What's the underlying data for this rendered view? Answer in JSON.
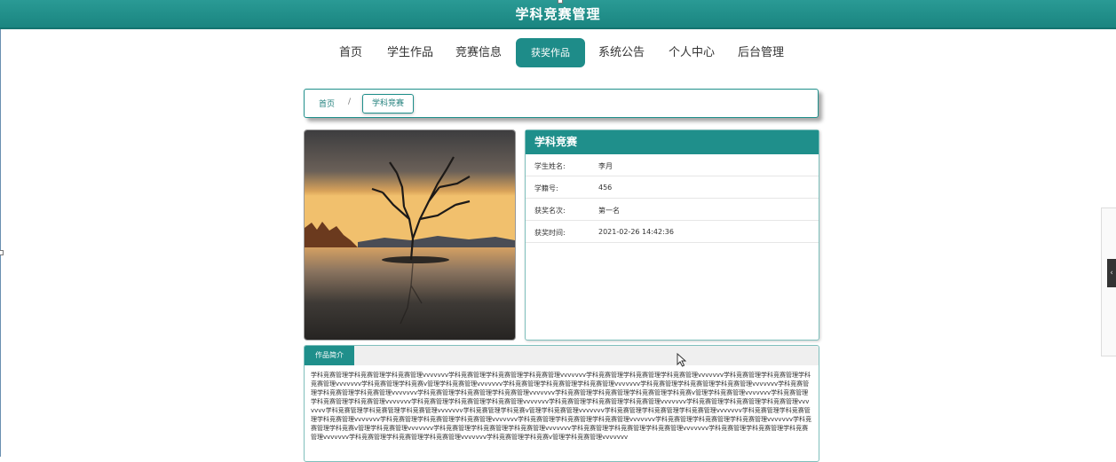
{
  "header": {
    "title": "学科竞赛管理"
  },
  "nav": {
    "items": [
      {
        "label": "首页"
      },
      {
        "label": "学生作品"
      },
      {
        "label": "竞赛信息"
      },
      {
        "label": "获奖作品"
      },
      {
        "label": "系统公告"
      },
      {
        "label": "个人中心"
      },
      {
        "label": "后台管理"
      }
    ],
    "active": "获奖作品"
  },
  "breadcrumb": {
    "home": "首页",
    "separator": "/",
    "current": "学科竞赛"
  },
  "detail": {
    "title": "学科竞赛",
    "fields": [
      {
        "label": "学生姓名:",
        "value": "李月"
      },
      {
        "label": "学籍号:",
        "value": "456"
      },
      {
        "label": "获奖名次:",
        "value": "第一名"
      },
      {
        "label": "获奖时间:",
        "value": "2021-02-26 14:42:36"
      }
    ]
  },
  "description": {
    "tab": "作品简介",
    "text": "学科竞赛管理学科竞赛管理学科竞赛管理vvvvvvv学科竞赛管理学科竞赛管理学科竞赛管理vvvvvvv学科竞赛管理学科竞赛管理学科竞赛管理vvvvvvv学科竞赛管理学科竞赛管理学科竞赛管理vvvvvvv学科竞赛管理学科竞赛v管理学科竞赛管理vvvvvvv学科竞赛管理学科竞赛管理学科竞赛管理vvvvvvv学科竞赛管理学科竞赛管理学科竞赛管理vvvvvvv学科竞赛管理学科竞赛管理学科竞赛管理vvvvvvv学科竞赛管理学科竞赛管理学科竞赛管理vvvvvvv学科竞赛管理学科竞赛管理学科竞赛管理学科竞赛v管理学科竞赛管理vvvvvvv学科竞赛管理学科竞赛管理学科竞赛管理vvvvvvv学科竞赛管理学科竞赛管理学科竞赛管理vvvvvvv学科竞赛管理学科竞赛管理学科竞赛管理vvvvvvv学科竞赛管理学科竞赛管理学科竞赛管理vvvvvvv学科竞赛管理学科竞赛管理学科竞赛管理vvvvvvv学科竞赛管理学科竞赛v管理学科竞赛管理vvvvvvv学科竞赛管理学科竞赛管理学科竞赛管理vvvvvvv学科竞赛管理学科竞赛管理学科竞赛管理vvvvvvv学科竞赛管理学科竞赛管理学科竞赛管理vvvvvvv学科竞赛管理学科竞赛管理学科竞赛管理vvvvvvv学科竞赛管理学科竞赛管理学科竞赛管理vvvvvvv学科竞赛管理学科竞赛v管理学科竞赛管理vvvvvvv学科竞赛管理学科竞赛管理学科竞赛管理vvvvvvv学科竞赛管理学科竞赛管理学科竞赛管理vvvvvvv学科竞赛管理学科竞赛管理学科竞赛管理vvvvvvv学科竞赛管理学科竞赛管理学科竞赛管理vvvvvvv学科竞赛管理学科竞赛v管理学科竞赛管理vvvvvvv"
  },
  "colors": {
    "primary": "#1f8f8b",
    "header": "#2a9a95"
  },
  "icons": {
    "cursor": "mouse-pointer-icon",
    "side_toggle": "chevron-left-icon"
  }
}
